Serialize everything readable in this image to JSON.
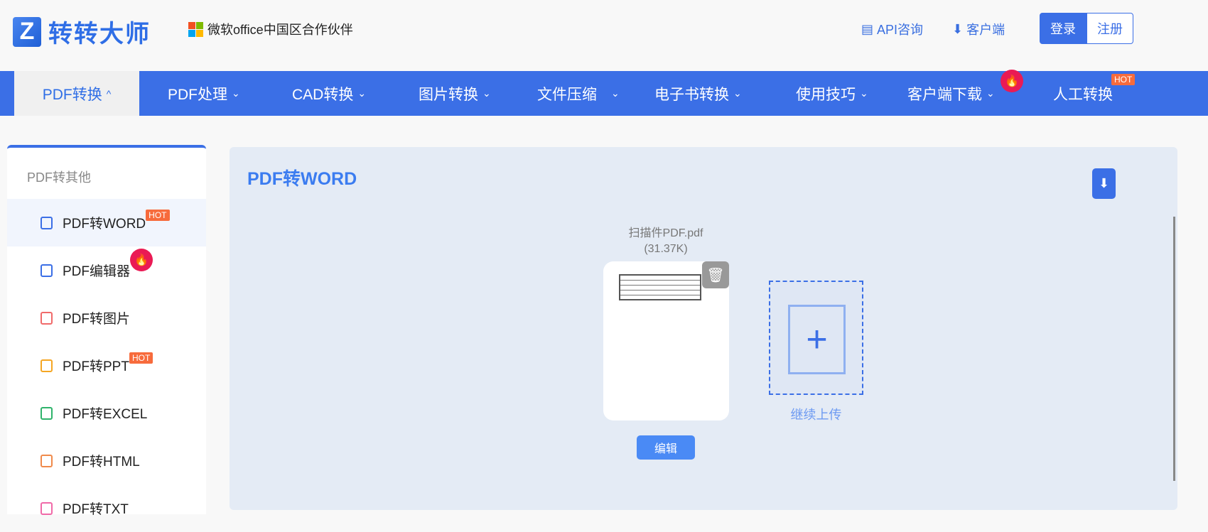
{
  "header": {
    "logo_letter": "Z",
    "logo_text": "转转大师",
    "partner": "微软office中国区合作伙伴",
    "api": "API咨询",
    "client": "客户端",
    "login": "登录",
    "register": "注册"
  },
  "nav": {
    "items": [
      {
        "label": "PDF转换",
        "chev": "^"
      },
      {
        "label": "PDF处理",
        "chev": "⌄"
      },
      {
        "label": "CAD转换",
        "chev": "⌄"
      },
      {
        "label": "图片转换",
        "chev": "⌄"
      },
      {
        "label": "文件压缩",
        "chev": "⌄"
      },
      {
        "label": "电子书转换",
        "chev": "⌄"
      },
      {
        "label": "使用技巧",
        "chev": "⌄"
      },
      {
        "label": "客户端下载",
        "chev": "⌄"
      },
      {
        "label": "人工转换",
        "chev": ""
      }
    ],
    "hot": "HOT"
  },
  "sidebar": {
    "heading": "PDF转其他",
    "items": [
      {
        "label": "PDF转WORD",
        "badge": "HOT",
        "color": "#3b6fe6"
      },
      {
        "label": "PDF编辑器",
        "badge": "fire",
        "color": "#3b6fe6"
      },
      {
        "label": "PDF转图片",
        "badge": "",
        "color": "#f06a6a"
      },
      {
        "label": "PDF转PPT",
        "badge": "HOT",
        "color": "#f5a623"
      },
      {
        "label": "PDF转EXCEL",
        "badge": "",
        "color": "#2fb36b"
      },
      {
        "label": "PDF转HTML",
        "badge": "",
        "color": "#f08a4b"
      },
      {
        "label": "PDF转TXT",
        "badge": "",
        "color": "#f06aa8"
      }
    ]
  },
  "main": {
    "title": "PDF转WORD",
    "file_name": "扫描件PDF.pdf",
    "file_size": "(31.37K)",
    "edit": "编辑",
    "upload_more": "继续上传"
  }
}
